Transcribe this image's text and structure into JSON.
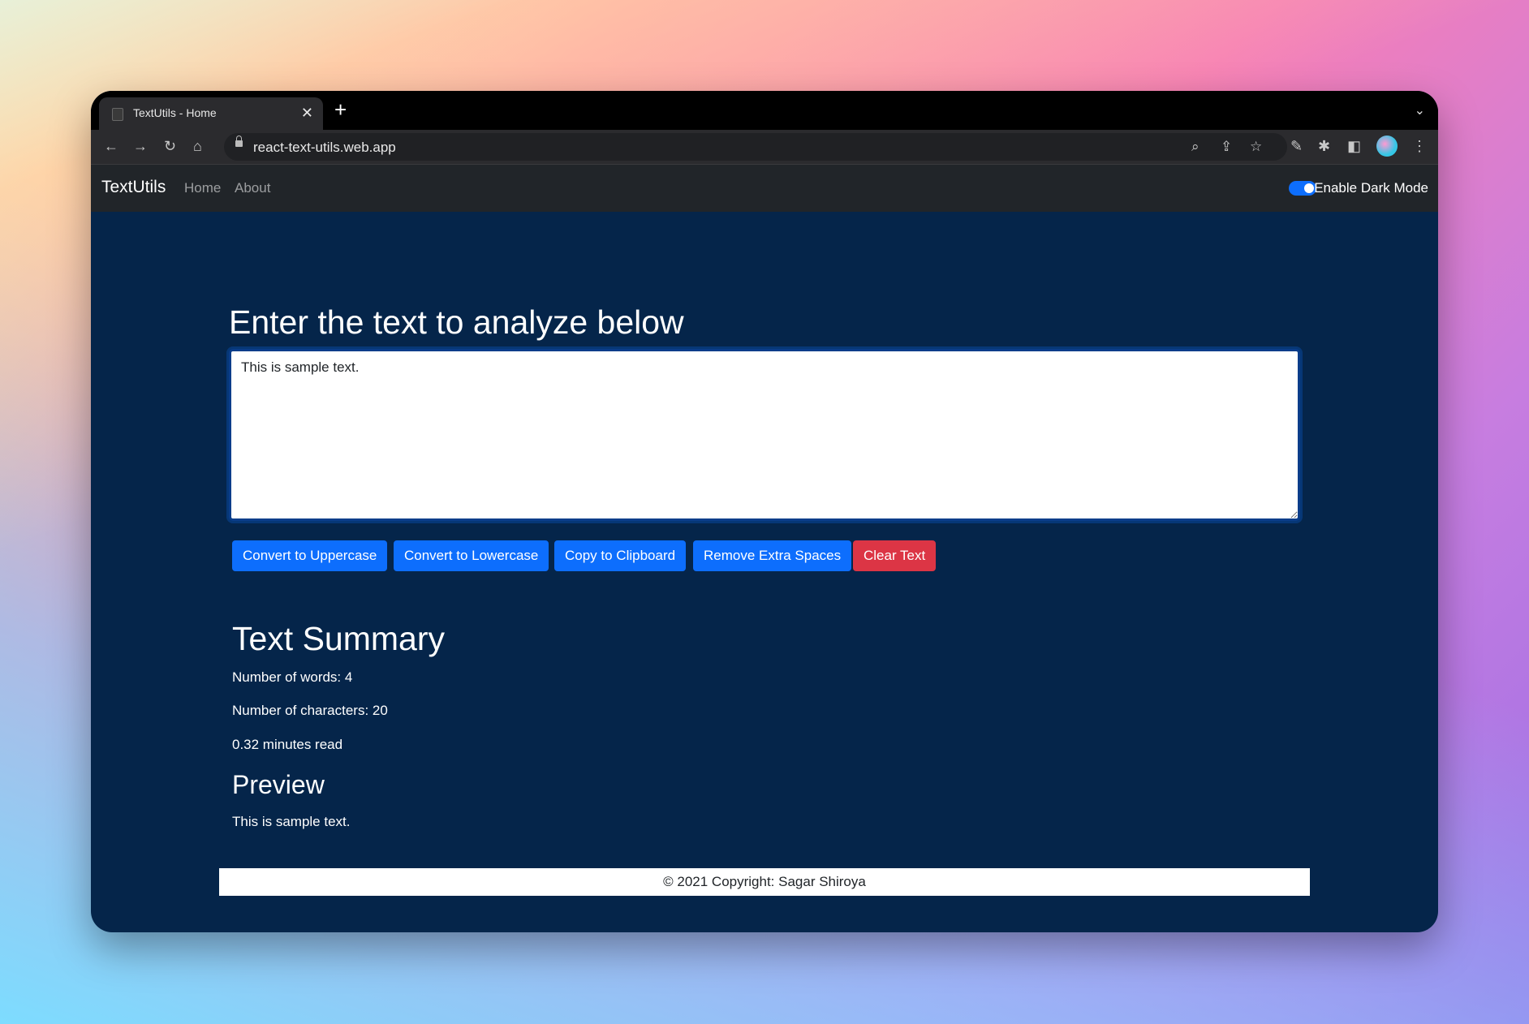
{
  "browser": {
    "tab_title": "TextUtils - Home",
    "url": "react-text-utils.web.app"
  },
  "navbar": {
    "brand": "TextUtils",
    "links": [
      "Home",
      "About"
    ],
    "dark_mode_label": "Enable Dark Mode",
    "dark_mode_on": true
  },
  "main": {
    "heading": "Enter the text to analyze below",
    "text_value": "This is sample text.",
    "buttons": [
      "Convert to Uppercase",
      "Convert to Lowercase",
      "Copy to Clipboard",
      "Remove Extra Spaces",
      "Clear Text"
    ]
  },
  "summary": {
    "heading": "Text Summary",
    "words": "Number of words: 4",
    "characters": "Number of characters: 20",
    "read_time": "0.32 minutes read",
    "preview_heading": "Preview",
    "preview_text": "This is sample text."
  },
  "footer": {
    "text": "© 2021 Copyright: Sagar Shiroya"
  },
  "colors": {
    "page_bg": "#05254a",
    "navbar_bg": "#212529",
    "primary": "#0d6efd",
    "danger": "#dc3545"
  }
}
